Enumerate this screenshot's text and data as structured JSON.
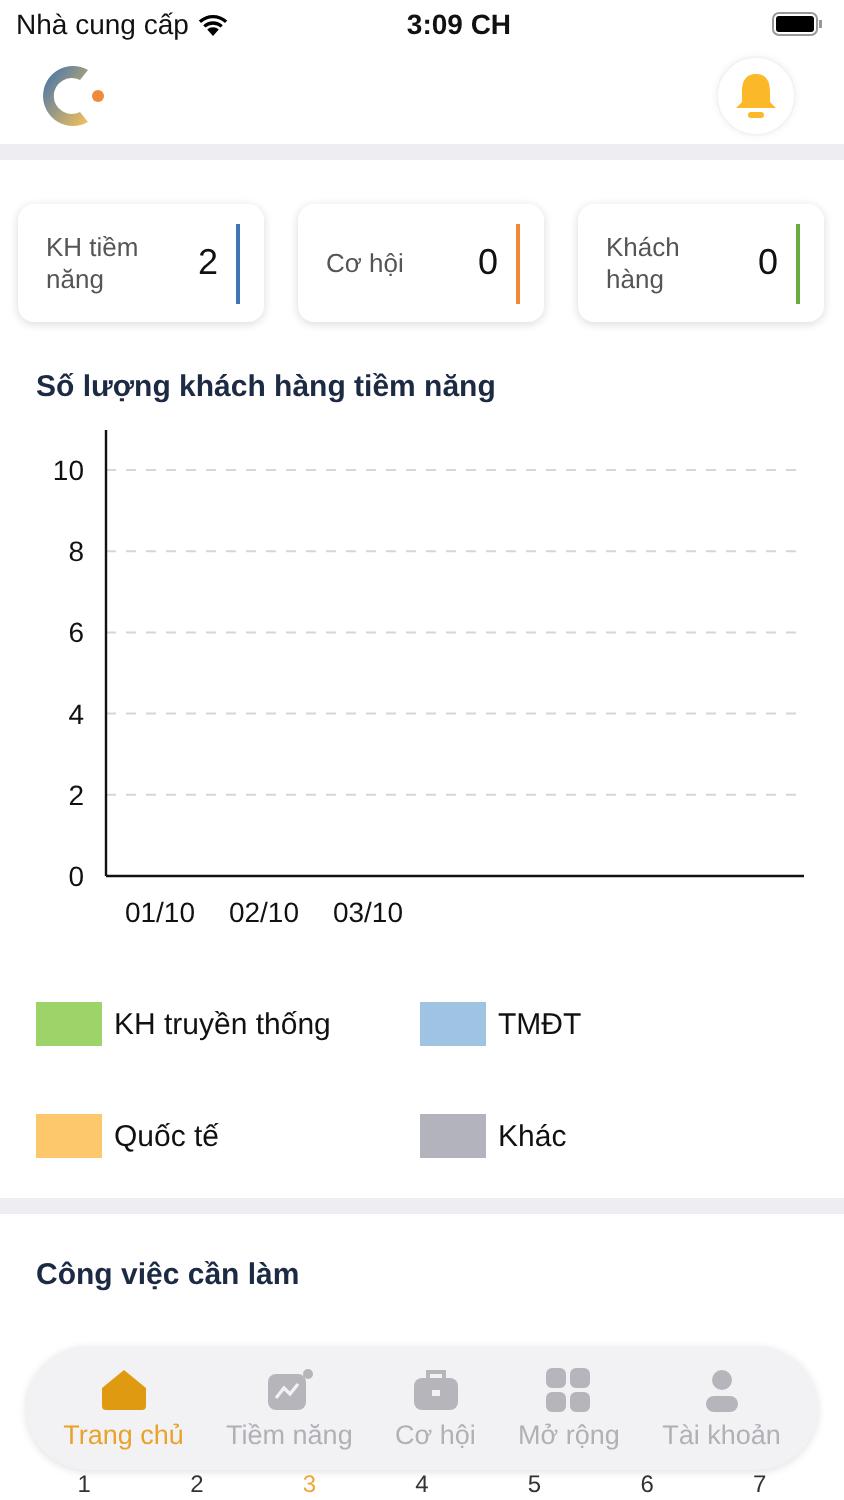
{
  "status_bar": {
    "carrier": "Nhà cung cấp",
    "time": "3:09 CH"
  },
  "stats": [
    {
      "label": "KH tiềm năng",
      "value": "2",
      "color": "#3f74b5"
    },
    {
      "label": "Cơ hội",
      "value": "0",
      "color": "#f0883a"
    },
    {
      "label": "Khách hàng",
      "value": "0",
      "color": "#6aab3f"
    }
  ],
  "chart": {
    "title": "Số lượng khách hàng tiềm năng",
    "chart_data": {
      "type": "bar",
      "grid": true,
      "categories": [
        "01/10",
        "02/10",
        "03/10"
      ],
      "ylim": [
        0,
        10
      ],
      "yticks": [
        0,
        2,
        4,
        6,
        8,
        10
      ],
      "series": [
        {
          "name": "KH truyền thống",
          "color": "#9ed36a",
          "values": [
            null,
            null,
            null
          ]
        },
        {
          "name": "TMĐT",
          "color": "#9ec3e3",
          "values": [
            null,
            null,
            null
          ]
        },
        {
          "name": "Quốc tế",
          "color": "#fdc86b",
          "values": [
            null,
            null,
            null
          ]
        },
        {
          "name": "Khác",
          "color": "#b3b3bd",
          "values": [
            null,
            null,
            null
          ]
        }
      ]
    }
  },
  "tasks": {
    "title": "Công việc cần làm",
    "days": [
      {
        "label": "1",
        "selected": false
      },
      {
        "label": "2",
        "selected": false
      },
      {
        "label": "3",
        "selected": true
      },
      {
        "label": "4",
        "selected": false
      },
      {
        "label": "5",
        "selected": false
      },
      {
        "label": "6",
        "selected": false
      },
      {
        "label": "7",
        "selected": false
      }
    ]
  },
  "nav": [
    {
      "label": "Trang chủ",
      "kind": "home",
      "selected": true
    },
    {
      "label": "Tiềm năng",
      "kind": "chart",
      "selected": false
    },
    {
      "label": "Cơ hội",
      "kind": "briefcase",
      "selected": false
    },
    {
      "label": "Mở rộng",
      "kind": "grid",
      "selected": false
    },
    {
      "label": "Tài khoản",
      "kind": "user",
      "selected": false
    }
  ]
}
